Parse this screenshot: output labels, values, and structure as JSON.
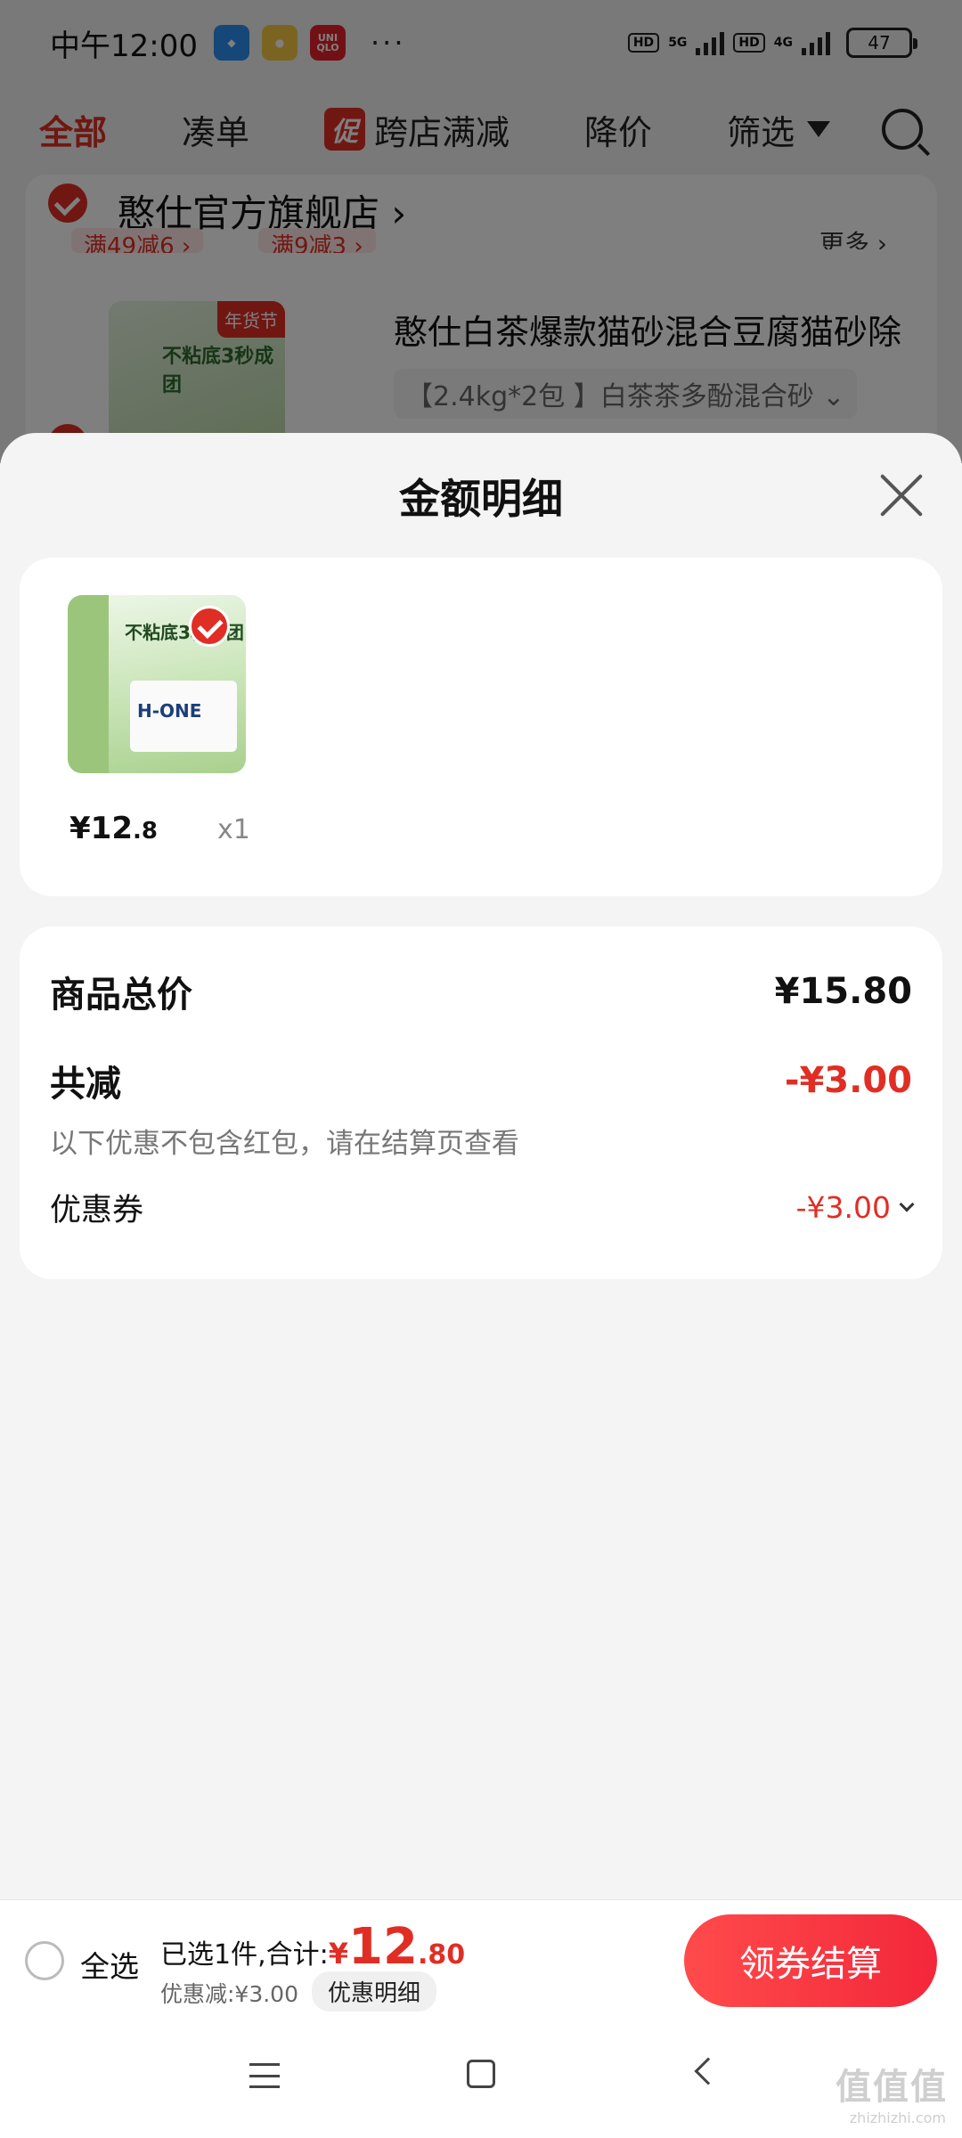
{
  "status_bar": {
    "time": "中午12:00",
    "more": "···",
    "app_icons": [
      "app-icon",
      "app-icon",
      "UNI QLO"
    ],
    "net1": "HD",
    "net1_type": "5G",
    "net2": "HD",
    "net2_type": "4G",
    "battery": "47"
  },
  "tabs": {
    "all": "全部",
    "bundle": "凑单",
    "promo_badge": "促",
    "cross_store": "跨店满减",
    "price_drop": "降价",
    "filter": "筛选"
  },
  "store": {
    "name": "憨仕官方旗舰店 ›",
    "coupon1": "满49减6 ›",
    "coupon2": "满9减3 ›",
    "more": "更多 ›"
  },
  "bg_product": {
    "tag": "年货节",
    "image_text": "不粘底3秒成团",
    "title": "憨仕白茶爆款猫砂混合豆腐猫砂除",
    "spec": "【2.4kg*2包 】白茶茶多酚混合砂 ⌄"
  },
  "sheet": {
    "title": "金额明细"
  },
  "item": {
    "image_headline": "不粘底3秒成团",
    "image_brand": "H-ONE",
    "price_int": "¥12",
    "price_dec": ".8",
    "qty": "x1"
  },
  "summary": {
    "total_label": "商品总价",
    "total_value": "¥15.80",
    "discount_label": "共减",
    "discount_value": "-¥3.00",
    "note": "以下优惠不包含红包，请在结算页查看",
    "coupon_label": "优惠券",
    "coupon_value": "-¥3.00"
  },
  "checkout": {
    "select_all": "全选",
    "selected_text": "已选1件,合计:",
    "currency": "¥",
    "total_int": "12",
    "total_dec": ".80",
    "savings": "优惠减:¥3.00",
    "detail_chip": "优惠明细",
    "button": "领券结算"
  },
  "watermark": {
    "main": "值值值",
    "sub": "zhizhizhi.com"
  },
  "colors": {
    "accent": "#e02e24",
    "button_gradient_start": "#ff4b4b",
    "button_gradient_end": "#f3273a"
  }
}
